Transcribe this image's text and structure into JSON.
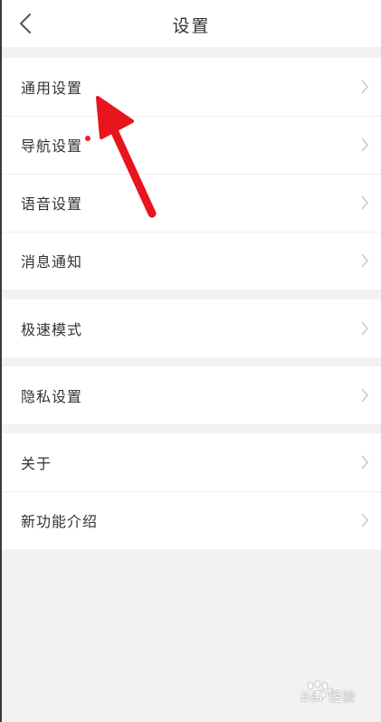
{
  "header": {
    "title": "设置",
    "back_icon": "chevron-left-icon"
  },
  "groups": [
    {
      "items": [
        {
          "label": "通用设置"
        },
        {
          "label": "导航设置",
          "badge": "red-dot"
        },
        {
          "label": "语音设置"
        },
        {
          "label": "消息通知"
        }
      ]
    },
    {
      "items": [
        {
          "label": "极速模式"
        }
      ]
    },
    {
      "items": [
        {
          "label": "隐私设置"
        }
      ]
    },
    {
      "items": [
        {
          "label": "关于"
        },
        {
          "label": "新功能介绍"
        }
      ]
    }
  ],
  "annotation": {
    "arrow_color": "#e8141e"
  },
  "watermark": {
    "text": "Bai 经验"
  },
  "colors": {
    "background": "#f2f2f2",
    "card": "#ffffff",
    "text": "#333333",
    "chevron": "#c8c8c8",
    "badge": "#e82020"
  }
}
